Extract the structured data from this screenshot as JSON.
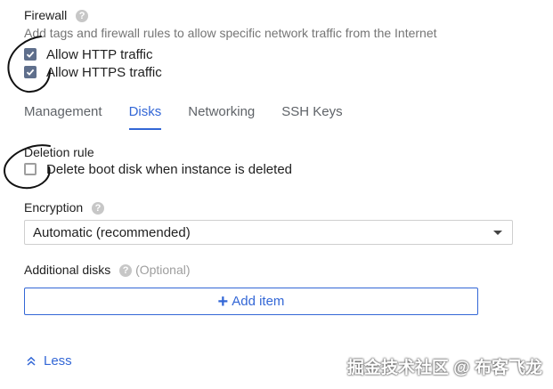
{
  "firewall": {
    "title": "Firewall",
    "help_icon": "help-circle-icon",
    "description": "Add tags and firewall rules to allow specific network traffic from the Internet",
    "options": [
      {
        "label": "Allow HTTP traffic",
        "checked": true
      },
      {
        "label": "Allow HTTPS traffic",
        "checked": true
      }
    ]
  },
  "tabs": [
    {
      "label": "Management",
      "active": false
    },
    {
      "label": "Disks",
      "active": true
    },
    {
      "label": "Networking",
      "active": false
    },
    {
      "label": "SSH Keys",
      "active": false
    }
  ],
  "deletion_rule": {
    "title": "Deletion rule",
    "option": {
      "label": "Delete boot disk when instance is deleted",
      "checked": false
    }
  },
  "encryption": {
    "title": "Encryption",
    "help_icon": "help-circle-icon",
    "selected": "Automatic (recommended)"
  },
  "additional_disks": {
    "title": "Additional disks",
    "help_icon": "help-circle-icon",
    "optional": "(Optional)",
    "add_button": "Add item"
  },
  "less_link": "Less",
  "watermark": "掘金技术社区 @ 布客飞龙",
  "colors": {
    "accent": "#3367d6",
    "checkbox": "#5f6f8c",
    "muted": "#757575"
  }
}
